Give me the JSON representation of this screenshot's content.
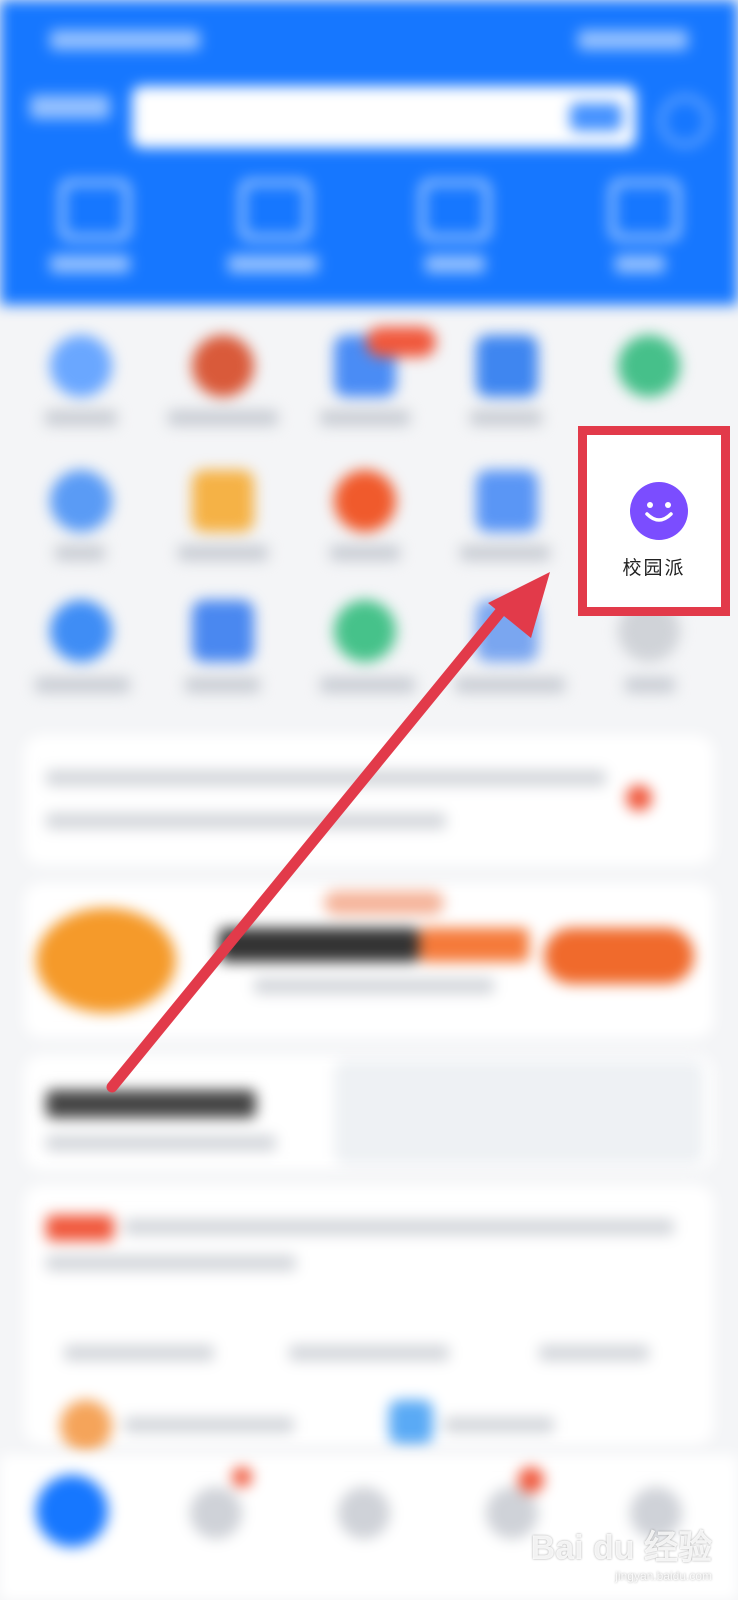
{
  "highlight": {
    "icon": "smile-icon",
    "label": "校园派",
    "icon_color": "#7b4dff",
    "box_color": "#e23a4a"
  },
  "annotation": {
    "arrow_color": "#e23a4a"
  },
  "watermark": {
    "brand": "Bai du 经验",
    "url": "jingyan.baidu.com"
  }
}
